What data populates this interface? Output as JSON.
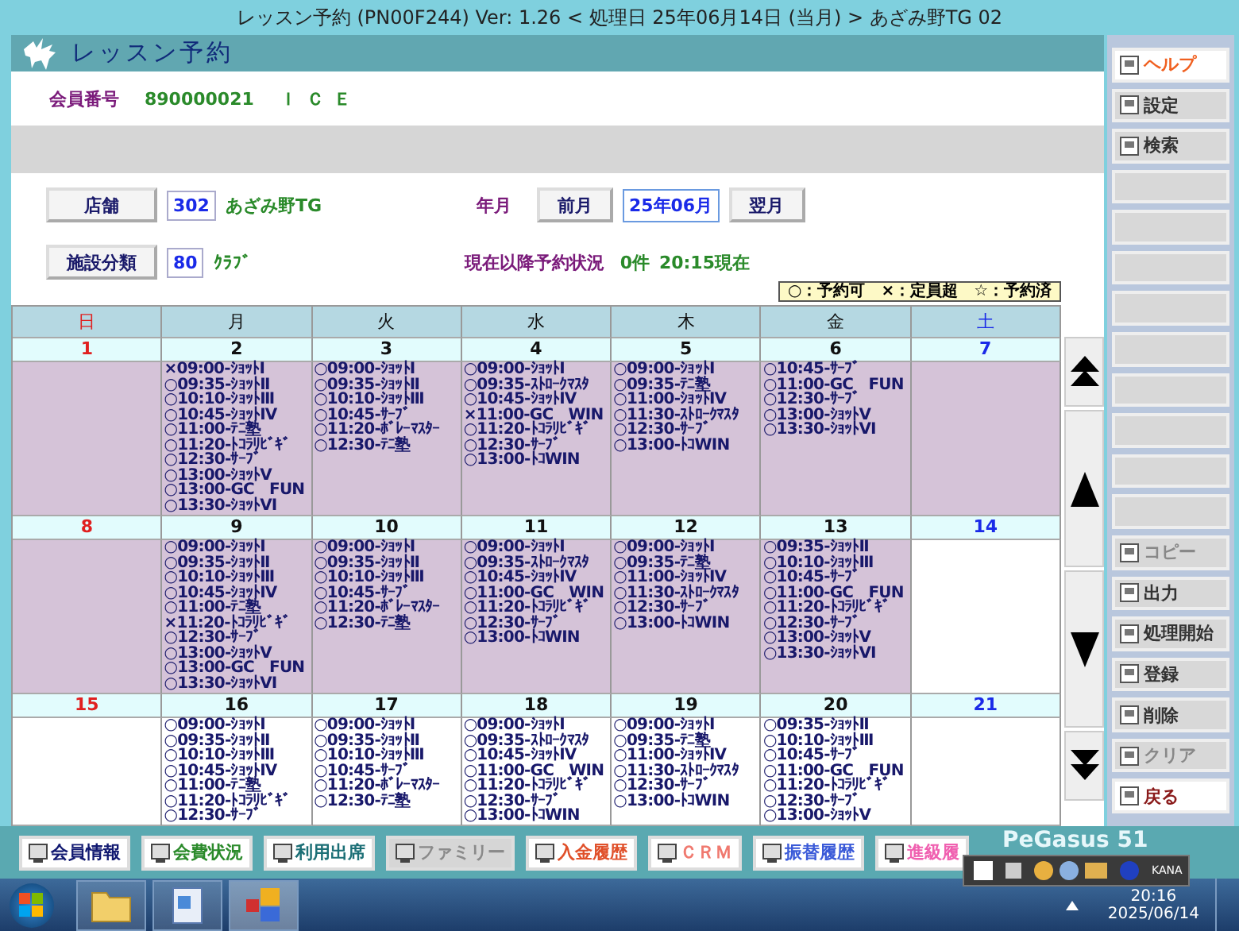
{
  "title_bar": {
    "title": "レッスン予約 (PN00F244) Ver: 1.26 < 処理日 25年06月14日 (当月) > あざみ野TG 02"
  },
  "header": {
    "title": "レッスン予約"
  },
  "member": {
    "label": "会員番号",
    "number": "890000021",
    "name": "ＩＣＥ"
  },
  "store": {
    "button": "店舗",
    "code": "302",
    "name": "あざみ野TG"
  },
  "month": {
    "label": "年月",
    "prev": "前月",
    "value": "25年06月",
    "next": "翌月"
  },
  "facility": {
    "button": "施設分類",
    "code": "80",
    "name": "ｸﾗﾌﾞ"
  },
  "status": {
    "label": "現在以降予約状況",
    "count": "0件",
    "time": "20:15現在"
  },
  "legend": "○：予約可　×：定員超　☆：予約済",
  "weekdays": [
    {
      "label": "日",
      "kind": "sun"
    },
    {
      "label": "月",
      "kind": "weekday"
    },
    {
      "label": "火",
      "kind": "weekday"
    },
    {
      "label": "水",
      "kind": "weekday"
    },
    {
      "label": "木",
      "kind": "weekday"
    },
    {
      "label": "金",
      "kind": "weekday"
    },
    {
      "label": "土",
      "kind": "sat"
    }
  ],
  "weeks": [
    [
      {
        "date": "1",
        "shaded": true
      },
      {
        "date": "2",
        "shaded": true,
        "entries": [
          "×09:00-ｼｮｯﾄⅠ",
          "○09:35-ｼｮｯﾄⅡ",
          "○10:10-ｼｮｯﾄⅢ",
          "○10:45-ｼｮｯﾄⅣ",
          "○11:00-ﾃﾆ塾",
          "○11:20-ﾄｺﾗﾘﾋﾞｷﾞ",
          "○12:30-ｻｰﾌﾞ",
          "○13:00-ｼｮｯﾄⅤ",
          "○13:00-GC　FUN",
          "○13:30-ｼｮｯﾄⅥ"
        ]
      },
      {
        "date": "3",
        "shaded": true,
        "entries": [
          "○09:00-ｼｮｯﾄⅠ",
          "○09:35-ｼｮｯﾄⅡ",
          "○10:10-ｼｮｯﾄⅢ",
          "○10:45-ｻｰﾌﾞ",
          "○11:20-ﾎﾞﾚｰﾏｽﾀｰ",
          "○12:30-ﾃﾆ塾"
        ]
      },
      {
        "date": "4",
        "shaded": true,
        "entries": [
          "○09:00-ｼｮｯﾄⅠ",
          "○09:35-ｽﾄﾛｰｸﾏｽﾀ",
          "○10:45-ｼｮｯﾄⅣ",
          "×11:00-GC　WIN",
          "○11:20-ﾄｺﾗﾘﾋﾞｷﾞ",
          "○12:30-ｻｰﾌﾞ",
          "○13:00-ﾄｺWIN"
        ]
      },
      {
        "date": "5",
        "shaded": true,
        "entries": [
          "○09:00-ｼｮｯﾄⅠ",
          "○09:35-ﾃﾆ塾",
          "○11:00-ｼｮｯﾄⅣ",
          "○11:30-ｽﾄﾛｰｸﾏｽﾀ",
          "○12:30-ｻｰﾌﾞ",
          "○13:00-ﾄｺWIN"
        ]
      },
      {
        "date": "6",
        "shaded": true,
        "entries": [
          "○10:45-ｻｰﾌﾞ",
          "○11:00-GC　FUN",
          "○12:30-ｻｰﾌﾞ",
          "○13:00-ｼｮｯﾄⅤ",
          "○13:30-ｼｮｯﾄⅥ"
        ]
      },
      {
        "date": "7",
        "shaded": true
      }
    ],
    [
      {
        "date": "8",
        "shaded": true
      },
      {
        "date": "9",
        "shaded": true,
        "entries": [
          "○09:00-ｼｮｯﾄⅠ",
          "○09:35-ｼｮｯﾄⅡ",
          "○10:10-ｼｮｯﾄⅢ",
          "○10:45-ｼｮｯﾄⅣ",
          "○11:00-ﾃﾆ塾",
          "×11:20-ﾄｺﾗﾘﾋﾞｷﾞ",
          "○12:30-ｻｰﾌﾞ",
          "○13:00-ｼｮｯﾄⅤ",
          "○13:00-GC　FUN",
          "○13:30-ｼｮｯﾄⅥ"
        ]
      },
      {
        "date": "10",
        "shaded": true,
        "entries": [
          "○09:00-ｼｮｯﾄⅠ",
          "○09:35-ｼｮｯﾄⅡ",
          "○10:10-ｼｮｯﾄⅢ",
          "○10:45-ｻｰﾌﾞ",
          "○11:20-ﾎﾞﾚｰﾏｽﾀｰ",
          "○12:30-ﾃﾆ塾"
        ]
      },
      {
        "date": "11",
        "shaded": true,
        "entries": [
          "○09:00-ｼｮｯﾄⅠ",
          "○09:35-ｽﾄﾛｰｸﾏｽﾀ",
          "○10:45-ｼｮｯﾄⅣ",
          "○11:00-GC　WIN",
          "○11:20-ﾄｺﾗﾘﾋﾞｷﾞ",
          "○12:30-ｻｰﾌﾞ",
          "○13:00-ﾄｺWIN"
        ]
      },
      {
        "date": "12",
        "shaded": true,
        "entries": [
          "○09:00-ｼｮｯﾄⅠ",
          "○09:35-ﾃﾆ塾",
          "○11:00-ｼｮｯﾄⅣ",
          "○11:30-ｽﾄﾛｰｸﾏｽﾀ",
          "○12:30-ｻｰﾌﾞ",
          "○13:00-ﾄｺWIN"
        ]
      },
      {
        "date": "13",
        "shaded": true,
        "entries": [
          "○09:35-ｼｮｯﾄⅡ",
          "○10:10-ｼｮｯﾄⅢ",
          "○10:45-ｻｰﾌﾞ",
          "○11:00-GC　FUN",
          "○11:20-ﾄｺﾗﾘﾋﾞｷﾞ",
          "○12:30-ｻｰﾌﾞ",
          "○13:00-ｼｮｯﾄⅤ",
          "○13:30-ｼｮｯﾄⅥ"
        ]
      },
      {
        "date": "14",
        "shaded": false
      }
    ],
    [
      {
        "date": "15",
        "shaded": false
      },
      {
        "date": "16",
        "shaded": false,
        "entries": [
          "○09:00-ｼｮｯﾄⅠ",
          "○09:35-ｼｮｯﾄⅡ",
          "○10:10-ｼｮｯﾄⅢ",
          "○10:45-ｼｮｯﾄⅣ",
          "○11:00-ﾃﾆ塾",
          "○11:20-ﾄｺﾗﾘﾋﾞｷﾞ",
          "○12:30-ｻｰﾌﾞ"
        ]
      },
      {
        "date": "17",
        "shaded": false,
        "entries": [
          "○09:00-ｼｮｯﾄⅠ",
          "○09:35-ｼｮｯﾄⅡ",
          "○10:10-ｼｮｯﾄⅢ",
          "○10:45-ｻｰﾌﾞ",
          "○11:20-ﾎﾞﾚｰﾏｽﾀｰ",
          "○12:30-ﾃﾆ塾"
        ]
      },
      {
        "date": "18",
        "shaded": false,
        "entries": [
          "○09:00-ｼｮｯﾄⅠ",
          "○09:35-ｽﾄﾛｰｸﾏｽﾀ",
          "○10:45-ｼｮｯﾄⅣ",
          "○11:00-GC　WIN",
          "○11:20-ﾄｺﾗﾘﾋﾞｷﾞ",
          "○12:30-ｻｰﾌﾞ",
          "○13:00-ﾄｺWIN"
        ]
      },
      {
        "date": "19",
        "shaded": false,
        "entries": [
          "○09:00-ｼｮｯﾄⅠ",
          "○09:35-ﾃﾆ塾",
          "○11:00-ｼｮｯﾄⅣ",
          "○11:30-ｽﾄﾛｰｸﾏｽﾀ",
          "○12:30-ｻｰﾌﾞ",
          "○13:00-ﾄｺWIN"
        ]
      },
      {
        "date": "20",
        "shaded": false,
        "entries": [
          "○09:35-ｼｮｯﾄⅡ",
          "○10:10-ｼｮｯﾄⅢ",
          "○10:45-ｻｰﾌﾞ",
          "○11:00-GC　FUN",
          "○11:20-ﾄｺﾗﾘﾋﾞｷﾞ",
          "○12:30-ｻｰﾌﾞ",
          "○13:00-ｼｮｯﾄⅤ"
        ]
      },
      {
        "date": "21",
        "shaded": false
      }
    ]
  ],
  "side_buttons": [
    {
      "label": "ヘルプ",
      "kind": "help",
      "disabled": false
    },
    {
      "label": "設定",
      "kind": "action",
      "disabled": false
    },
    {
      "label": "検索",
      "kind": "action",
      "disabled": false
    },
    {
      "kind": "blank"
    },
    {
      "kind": "blank"
    },
    {
      "kind": "blank"
    },
    {
      "kind": "blank"
    },
    {
      "kind": "blank"
    },
    {
      "kind": "blank"
    },
    {
      "kind": "blank"
    },
    {
      "kind": "blank"
    },
    {
      "kind": "blank"
    },
    {
      "label": "コピー",
      "kind": "action",
      "disabled": true
    },
    {
      "label": "出力",
      "kind": "action",
      "disabled": false
    },
    {
      "label": "処理開始",
      "kind": "action",
      "disabled": false
    },
    {
      "label": "登録",
      "kind": "action",
      "disabled": false
    },
    {
      "label": "削除",
      "kind": "action",
      "disabled": false
    },
    {
      "label": "クリア",
      "kind": "action",
      "disabled": true
    },
    {
      "label": "戻る",
      "kind": "back",
      "disabled": false
    }
  ],
  "bottom_buttons": [
    {
      "label": "会員情報",
      "color": "#101870",
      "disabled": false
    },
    {
      "label": "会費状況",
      "color": "#2a8a2a",
      "disabled": false
    },
    {
      "label": "利用出席",
      "color": "#1c6f76",
      "disabled": false
    },
    {
      "label": "ファミリー",
      "color": "#8a8a8a",
      "disabled": true
    },
    {
      "label": "入金履歴",
      "color": "#e0502a",
      "disabled": false
    },
    {
      "label": "ＣＲＭ",
      "color": "#f07a70",
      "disabled": false
    },
    {
      "label": "振替履歴",
      "color": "#3a5ad8",
      "disabled": false
    },
    {
      "label": "進級履",
      "color": "#f060b0",
      "disabled": false
    }
  ],
  "brand": "PeGasus 51",
  "ime_bar": {
    "mode": "KANA"
  },
  "clock": {
    "time": "20:16",
    "date": "2025/06/14"
  }
}
